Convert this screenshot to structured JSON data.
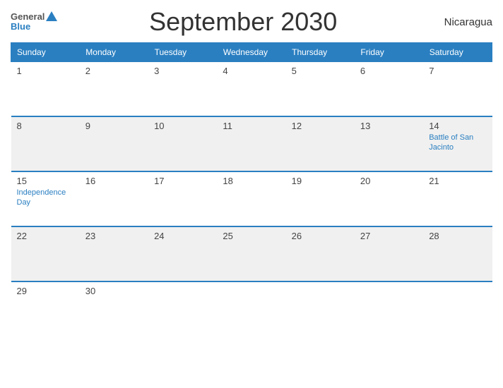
{
  "header": {
    "logo": {
      "general": "General",
      "blue": "Blue"
    },
    "title": "September 2030",
    "country": "Nicaragua"
  },
  "weekdays": [
    "Sunday",
    "Monday",
    "Tuesday",
    "Wednesday",
    "Thursday",
    "Friday",
    "Saturday"
  ],
  "weeks": [
    [
      {
        "date": "1",
        "event": ""
      },
      {
        "date": "2",
        "event": ""
      },
      {
        "date": "3",
        "event": ""
      },
      {
        "date": "4",
        "event": ""
      },
      {
        "date": "5",
        "event": ""
      },
      {
        "date": "6",
        "event": ""
      },
      {
        "date": "7",
        "event": ""
      }
    ],
    [
      {
        "date": "8",
        "event": ""
      },
      {
        "date": "9",
        "event": ""
      },
      {
        "date": "10",
        "event": ""
      },
      {
        "date": "11",
        "event": ""
      },
      {
        "date": "12",
        "event": ""
      },
      {
        "date": "13",
        "event": ""
      },
      {
        "date": "14",
        "event": "Battle of San Jacinto"
      }
    ],
    [
      {
        "date": "15",
        "event": "Independence Day"
      },
      {
        "date": "16",
        "event": ""
      },
      {
        "date": "17",
        "event": ""
      },
      {
        "date": "18",
        "event": ""
      },
      {
        "date": "19",
        "event": ""
      },
      {
        "date": "20",
        "event": ""
      },
      {
        "date": "21",
        "event": ""
      }
    ],
    [
      {
        "date": "22",
        "event": ""
      },
      {
        "date": "23",
        "event": ""
      },
      {
        "date": "24",
        "event": ""
      },
      {
        "date": "25",
        "event": ""
      },
      {
        "date": "26",
        "event": ""
      },
      {
        "date": "27",
        "event": ""
      },
      {
        "date": "28",
        "event": ""
      }
    ],
    [
      {
        "date": "29",
        "event": ""
      },
      {
        "date": "30",
        "event": ""
      },
      {
        "date": "",
        "event": ""
      },
      {
        "date": "",
        "event": ""
      },
      {
        "date": "",
        "event": ""
      },
      {
        "date": "",
        "event": ""
      },
      {
        "date": "",
        "event": ""
      }
    ]
  ]
}
